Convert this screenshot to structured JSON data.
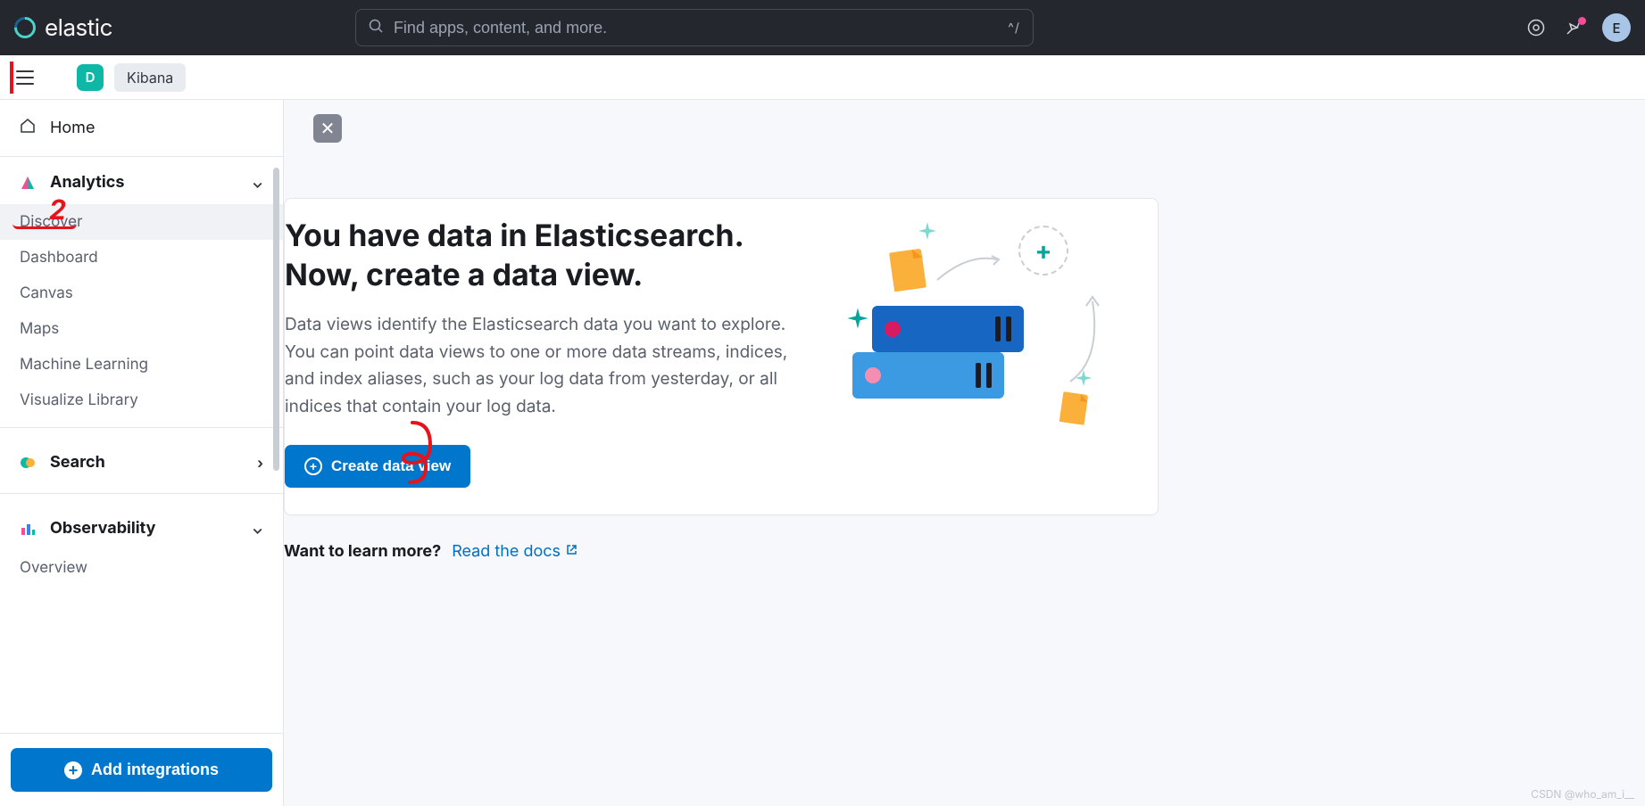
{
  "header": {
    "brand": "elastic",
    "search_placeholder": "Find apps, content, and more.",
    "kbd_hint": "^/",
    "avatar_letter": "E"
  },
  "subheader": {
    "space_letter": "D",
    "app_label": "Kibana"
  },
  "sidebar": {
    "home_label": "Home",
    "sections": {
      "analytics": {
        "title": "Analytics",
        "items": [
          "Discover",
          "Dashboard",
          "Canvas",
          "Maps",
          "Machine Learning",
          "Visualize Library"
        ]
      },
      "search": {
        "title": "Search"
      },
      "observability": {
        "title": "Observability",
        "items": [
          "Overview"
        ]
      }
    },
    "add_integrations_label": "Add integrations"
  },
  "main": {
    "title_line1": "You have data in Elasticsearch.",
    "title_line2": "Now, create a data view.",
    "description": "Data views identify the Elasticsearch data you want to explore. You can point data views to one or more data streams, indices, and index aliases, such as your log data from yesterday, or all indices that contain your log data.",
    "create_button_label": "Create data view",
    "learn_more_label": "Want to learn more?",
    "docs_link_label": "Read the docs"
  },
  "annotations": {
    "num2": "2"
  },
  "watermark": "CSDN @who_am_i__"
}
